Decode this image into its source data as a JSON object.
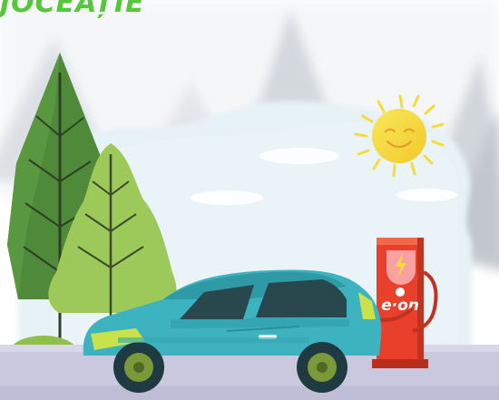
{
  "headline": "JOCEAȚIE",
  "charger": {
    "brand_label": "e·on"
  },
  "icons": [
    "sun-icon",
    "lightning-bolt-icon",
    "pine-tree-icon",
    "car-icon",
    "ev-charger-icon"
  ],
  "colors": {
    "headline": "#55c83a",
    "sky": "#eaf4f8",
    "tree_dark": "#4f8a3a",
    "tree_light": "#9dc85a",
    "car_body": "#3db3c0",
    "car_accent": "#c9e14a",
    "charger": "#e8402a",
    "sun": "#f5dc3a",
    "ground": "#c7c6dc"
  }
}
